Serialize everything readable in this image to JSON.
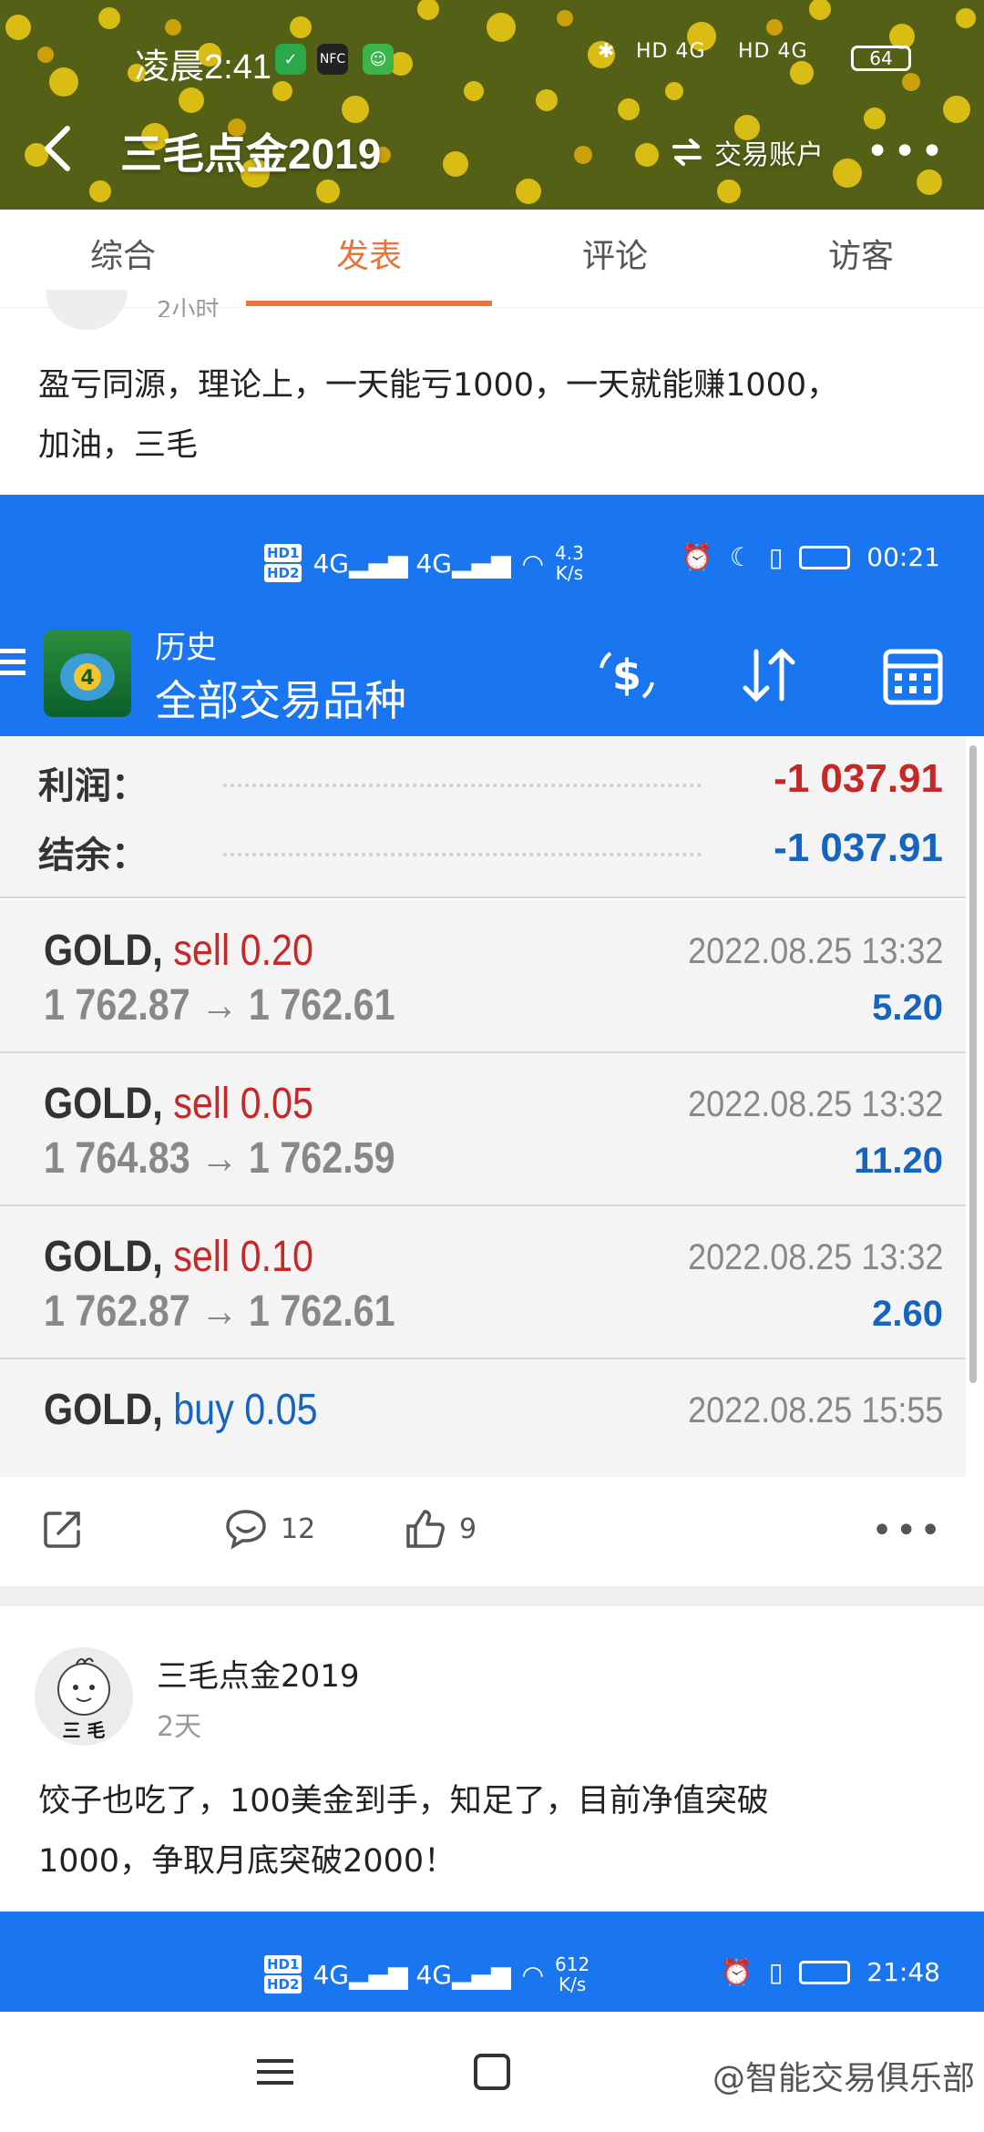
{
  "status_bar": {
    "time": "凌晨2:41",
    "network": "HD 4G",
    "network2": "HD 4G",
    "battery": "64"
  },
  "header": {
    "title": "三毛点金2019",
    "account_label": "交易账户",
    "more": "•••"
  },
  "tabs": [
    {
      "label": "综合"
    },
    {
      "label": "发表"
    },
    {
      "label": "评论"
    },
    {
      "label": "访客"
    }
  ],
  "post1": {
    "time_partial": "2小时",
    "text_line1": "盈亏同源，理论上，一天能亏1000，一天就能赚1000，",
    "text_line2": "加油，三毛",
    "screenshot": {
      "status": {
        "speed": "4.3",
        "speed_unit": "K/s",
        "time": "00:21"
      },
      "app_subtitle": "历史",
      "app_title": "全部交易品种",
      "profit_label": "利润：",
      "profit_value": "-1 037.91",
      "balance_label": "结余：",
      "balance_value": "-1 037.91",
      "trades": [
        {
          "symbol": "GOLD,",
          "side": "sell",
          "lots": "0.20",
          "date": "2022.08.25 13:32",
          "open": "1 762.87",
          "close": "1 762.61",
          "profit": "5.20"
        },
        {
          "symbol": "GOLD,",
          "side": "sell",
          "lots": "0.05",
          "date": "2022.08.25 13:32",
          "open": "1 764.83",
          "close": "1 762.59",
          "profit": "11.20"
        },
        {
          "symbol": "GOLD,",
          "side": "sell",
          "lots": "0.10",
          "date": "2022.08.25 13:32",
          "open": "1 762.87",
          "close": "1 762.61",
          "profit": "2.60"
        },
        {
          "symbol": "GOLD,",
          "side": "buy",
          "lots": "0.05",
          "date": "2022.08.25 15:55",
          "open": "",
          "close": "",
          "profit": ""
        }
      ]
    },
    "actions": {
      "comments": "12",
      "likes": "9",
      "more": "•••"
    }
  },
  "post2": {
    "author": "三毛点金2019",
    "time": "2天",
    "avatar_text": "三 毛",
    "text_line1": "饺子也吃了，100美金到手，知足了，目前净值突破",
    "text_line2": "1000，争取月底突破2000！",
    "screenshot": {
      "status": {
        "speed": "612",
        "speed_unit": "K/s",
        "time": "21:48"
      }
    }
  },
  "watermark": "@智能交易俱乐部",
  "colors": {
    "accent": "#e8743b",
    "mt_blue": "#1976f0",
    "loss_red": "#c62828",
    "profit_blue": "#1565c0"
  }
}
